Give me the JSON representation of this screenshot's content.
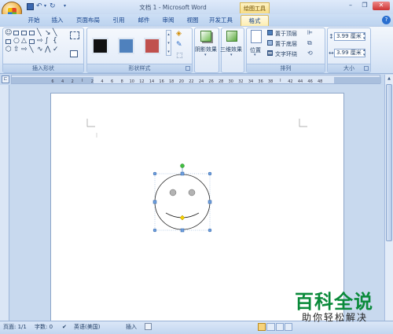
{
  "window": {
    "title": "文档 1 - Microsoft Word",
    "contextual_tab_group": "绘图工具"
  },
  "tabs": [
    {
      "id": "home",
      "label": "开始"
    },
    {
      "id": "insert",
      "label": "插入"
    },
    {
      "id": "layout",
      "label": "页面布局"
    },
    {
      "id": "references",
      "label": "引用"
    },
    {
      "id": "mailings",
      "label": "邮件"
    },
    {
      "id": "review",
      "label": "审阅"
    },
    {
      "id": "view",
      "label": "视图"
    },
    {
      "id": "developer",
      "label": "开发工具"
    },
    {
      "id": "format",
      "label": "格式"
    }
  ],
  "ribbon": {
    "insert_shapes": {
      "label": "插入形状"
    },
    "shape_styles": {
      "label": "形状样式",
      "swatches": [
        "#111111",
        "#4f81bd",
        "#c0504d"
      ]
    },
    "shadow": {
      "label": "阴影效果"
    },
    "threed": {
      "label": "三维效果"
    },
    "arrange": {
      "label": "排列",
      "position": "位置",
      "bring_front": "置于顶层",
      "send_back": "置于底层",
      "text_wrap": "文字环绕"
    },
    "size": {
      "label": "大小",
      "height": "3.99 厘米",
      "width": "3.99 厘米"
    }
  },
  "ruler": {
    "ticks": [
      "6",
      "4",
      "2",
      "",
      "2",
      "4",
      "6",
      "8",
      "10",
      "12",
      "14",
      "16",
      "18",
      "20",
      "22",
      "24",
      "26",
      "28",
      "30",
      "32",
      "34",
      "36",
      "38",
      "",
      "42",
      "44",
      "46",
      "48"
    ]
  },
  "status": {
    "page": "页面: 1/1",
    "words": "字数: 0",
    "language": "英语(美国)",
    "mode": "插入"
  },
  "watermark": {
    "big": "百科全说",
    "small": "助你轻松解决"
  },
  "colors": {
    "accent": "#15428b",
    "format_tab": "#fdeeb0",
    "ribbon": "#dbe7f7",
    "watermark": "#0a8a3a"
  }
}
